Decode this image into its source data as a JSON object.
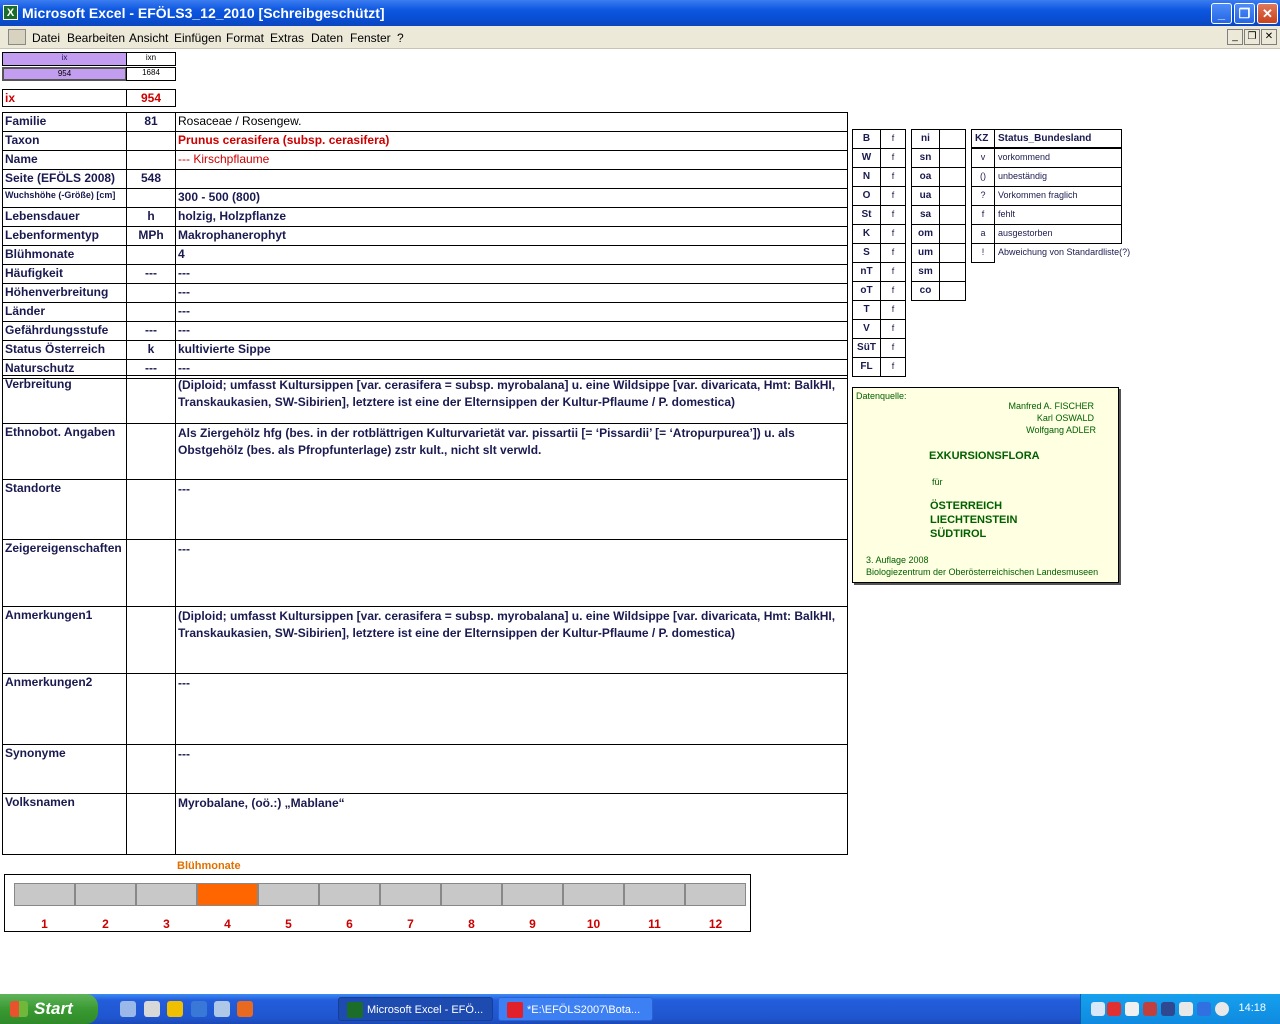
{
  "window": {
    "title": "Microsoft Excel - EFÖLS3_12_2010  [Schreibgeschützt]"
  },
  "menu": [
    "Datei",
    "Bearbeiten",
    "Ansicht",
    "Einfügen",
    "Format",
    "Extras",
    "Daten",
    "Fenster",
    "?"
  ],
  "header_cells": {
    "ix_label": "ix",
    "ixn_label": "ixn",
    "ix_value": "954",
    "ixn_value": "1684"
  },
  "record_ix": {
    "label": "ix",
    "value": "954"
  },
  "fields": [
    {
      "label": "Familie",
      "code": "81",
      "value": "Rosaceae  /  Rosengew."
    },
    {
      "label": "Taxon",
      "code": "",
      "value": "Prunus cerasifera (subsp. cerasifera)"
    },
    {
      "label": "Name",
      "code": "",
      "value": "--- Kirschpflaume"
    },
    {
      "label": "Seite (EFÖLS 2008)",
      "code": "548",
      "value": ""
    },
    {
      "label": "Wuchshöhe (-Größe) [cm]",
      "code": "",
      "value": "300 - 500 (800)"
    },
    {
      "label": "Lebensdauer",
      "code": "h",
      "value": "holzig, Holzpflanze"
    },
    {
      "label": "Lebenformentyp",
      "code": "MPh",
      "value": "Makrophanerophyt"
    },
    {
      "label": "Blühmonate",
      "code": "",
      "value": "4"
    },
    {
      "label": "Häufigkeit",
      "code": "---",
      "value": "---"
    },
    {
      "label": "Höhenverbreitung",
      "code": "",
      "value": "---"
    },
    {
      "label": "Länder",
      "code": "",
      "value": "---"
    },
    {
      "label": "Gefährdungsstufe",
      "code": "---",
      "value": "---"
    },
    {
      "label": "Status Österreich",
      "code": "k",
      "value": "kultivierte Sippe"
    },
    {
      "label": "Naturschutz",
      "code": "---",
      "value": "---"
    }
  ],
  "long_fields": [
    {
      "label": "Verbreitung",
      "value": "(Diploid; umfasst Kultursippen [var. cerasifera = subsp. myrobalana] u. eine Wildsippe [var. divaricata, Hmt: BalkHI, Transkaukasien, SW-Sibirien], letztere ist eine der Elternsippen der Kultur-Pflaume / P. domestica)"
    },
    {
      "label": "Ethnobot. Angaben",
      "value": "Als Ziergehölz hfg (bes. in der rotblättrigen Kulturvarietät var. pissartii [= ‘Pissardii’ [= ‘Atropurpurea’]) u. als Obstgehölz (bes. als Pfropfunterlage) zstr kult., nicht slt verwld."
    },
    {
      "label": "Standorte",
      "value": "---"
    },
    {
      "label": "Zeigereigenschaften",
      "value": "---"
    },
    {
      "label": "Anmerkungen1",
      "value": "(Diploid; umfasst Kultursippen [var. cerasifera = subsp. myrobalana] u. eine Wildsippe [var. divaricata, Hmt: BalkHI, Transkaukasien, SW-Sibirien], letztere ist eine der Elternsippen der Kultur-Pflaume / P. domestica)"
    },
    {
      "label": "Anmerkungen2",
      "value": "---"
    },
    {
      "label": "Synonyme",
      "value": "---"
    },
    {
      "label": "Volksnamen",
      "value": "Myrobalane, (oö.:) „Mablane“"
    }
  ],
  "region_codes": [
    {
      "code": "B",
      "flag": "f"
    },
    {
      "code": "W",
      "flag": "f"
    },
    {
      "code": "N",
      "flag": "f"
    },
    {
      "code": "O",
      "flag": "f"
    },
    {
      "code": "St",
      "flag": "f"
    },
    {
      "code": "K",
      "flag": "f"
    },
    {
      "code": "S",
      "flag": "f"
    },
    {
      "code": "nT",
      "flag": "f"
    },
    {
      "code": "oT",
      "flag": "f"
    },
    {
      "code": "T",
      "flag": "f"
    },
    {
      "code": "V",
      "flag": "f"
    },
    {
      "code": "SüT",
      "flag": "f"
    },
    {
      "code": "FL",
      "flag": "f"
    }
  ],
  "altitude_codes": [
    "ni",
    "sn",
    "oa",
    "ua",
    "sa",
    "om",
    "um",
    "sm",
    "co"
  ],
  "status_legend": {
    "header_kz": "KZ",
    "header": "Status_Bundesland",
    "rows": [
      {
        "kz": "v",
        "text": "vorkommend"
      },
      {
        "kz": "()",
        "text": "unbeständig"
      },
      {
        "kz": "?",
        "text": "Vorkommen fraglich"
      },
      {
        "kz": "f",
        "text": "fehlt"
      },
      {
        "kz": "a",
        "text": "ausgestorben"
      },
      {
        "kz": "!",
        "text": "Abweichung von Standardliste(?)"
      }
    ]
  },
  "source": {
    "label": "Datenquelle:",
    "authors": [
      "Manfred A. FISCHER",
      "Karl OSWALD",
      "Wolfgang ADLER"
    ],
    "book_title": "EXKURSIONSFLORA",
    "fuer": "für",
    "regions": [
      "ÖSTERREICH",
      "LIECHTENSTEIN",
      "SÜDTIROL"
    ],
    "edition": "3. Auflage 2008",
    "publisher": "Biologiezentrum der Oberösterreichischen Landesmuseen"
  },
  "bloom": {
    "title": "Blühmonate",
    "months": [
      "1",
      "2",
      "3",
      "4",
      "5",
      "6",
      "7",
      "8",
      "9",
      "10",
      "11",
      "12"
    ],
    "active_month": 4,
    "active_color": "#ff6600"
  },
  "taskbar": {
    "start": "Start",
    "tasks": [
      "Microsoft Excel - EFÖ...",
      "*E:\\EFÖLS2007\\Bota..."
    ],
    "clock": "14:18"
  }
}
